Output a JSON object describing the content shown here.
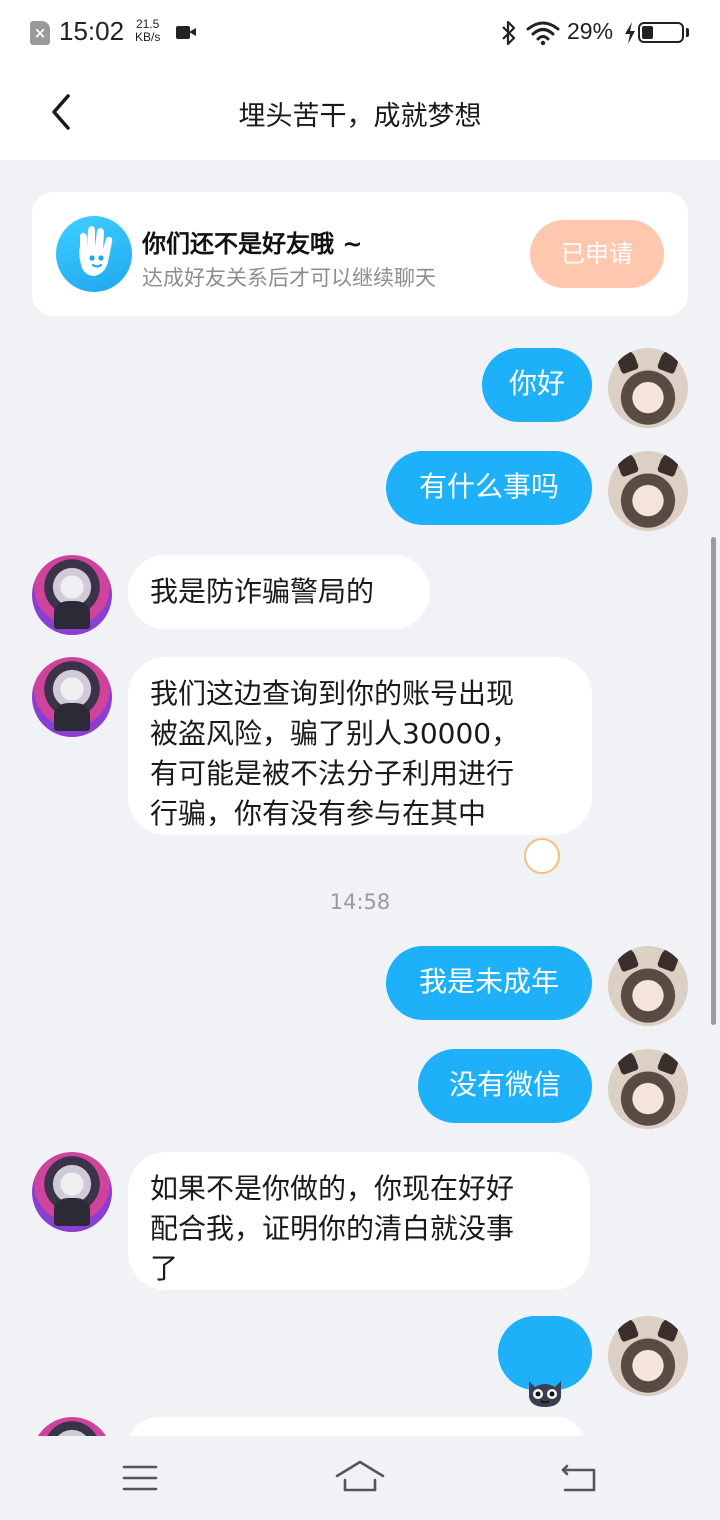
{
  "status_bar": {
    "time": "15:02",
    "net_speed_value": "21.5",
    "net_speed_unit": "KB/s",
    "battery_percent": "29%",
    "battery_level": 0.29,
    "icons": [
      "sim-error-icon",
      "video-icon",
      "bluetooth-icon",
      "wifi-icon",
      "charging-icon",
      "battery-icon"
    ]
  },
  "header": {
    "title": "埋头苦干，成就梦想",
    "back_icon": "chevron-left-icon"
  },
  "friend_notice": {
    "title": "你们还不是好友哦 ~",
    "subtitle": "达成好友关系后才可以继续聊天",
    "button_label": "已申请",
    "icon": "waving-hand-icon"
  },
  "messages": [
    {
      "sender": "me",
      "text": "你好"
    },
    {
      "sender": "me",
      "text": "有什么事吗"
    },
    {
      "sender": "them",
      "text": "我是防诈骗警局的"
    },
    {
      "sender": "them",
      "text": "我们这边查询到你的账号出现\n被盗风险，骗了别人30000，\n有可能是被不法分子利用进行\n行骗，你有没有参与在其中"
    },
    {
      "sender": "me",
      "text": "我是未成年"
    },
    {
      "sender": "me",
      "text": "没有微信"
    },
    {
      "sender": "them",
      "text": "如果不是你做的，你现在好好\n配合我，证明你的清白就没事\n了"
    },
    {
      "sender": "me",
      "text": "",
      "sticker": "cat-face-sticker"
    }
  ],
  "timestamp": "14:58",
  "nav_bar": {
    "icons": [
      "menu-icon",
      "home-icon",
      "back-icon"
    ]
  },
  "colors": {
    "my_bubble": "#1eb0f9",
    "their_bubble": "#ffffff",
    "background": "#f1f2f6",
    "applied_button": "#ffc7ad"
  }
}
